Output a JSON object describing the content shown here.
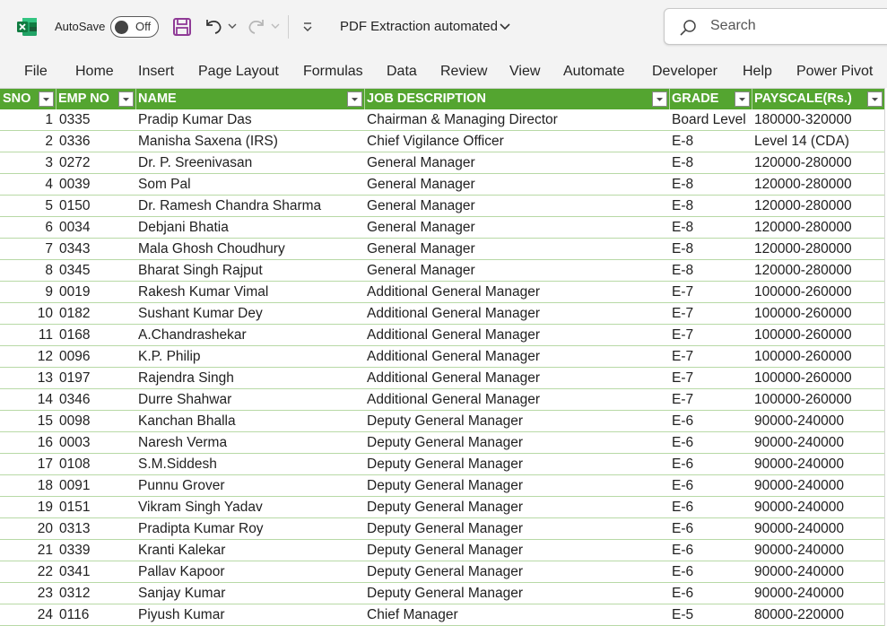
{
  "titlebar": {
    "autosave_label": "AutoSave",
    "autosave_state": "Off",
    "document_title": "PDF Extraction automated",
    "search_placeholder": "Search"
  },
  "ribbon": {
    "tabs": [
      "File",
      "Home",
      "Insert",
      "Page Layout",
      "Formulas",
      "Data",
      "Review",
      "View",
      "Automate",
      "Developer",
      "Help",
      "Power Pivot"
    ]
  },
  "colors": {
    "header_green": "#54a530",
    "row_border": "#b8d9a6",
    "excel_green": "#107c41",
    "save_purple": "#8f3a96"
  },
  "table": {
    "headers": [
      "SNO",
      "EMP NO",
      "NAME",
      "JOB DESCRIPTION",
      "GRADE",
      "PAYSCALE(Rs.)"
    ],
    "rows": [
      [
        "1",
        "0335",
        "Pradip Kumar Das",
        "Chairman & Managing Director",
        "Board Level",
        "180000-320000"
      ],
      [
        "2",
        "0336",
        "Manisha Saxena (IRS)",
        "Chief Vigilance Officer",
        "E-8",
        "Level 14 (CDA)"
      ],
      [
        "3",
        "0272",
        "Dr. P. Sreenivasan",
        "General Manager",
        "E-8",
        "120000-280000"
      ],
      [
        "4",
        "0039",
        "Som Pal",
        "General Manager",
        "E-8",
        "120000-280000"
      ],
      [
        "5",
        "0150",
        "Dr. Ramesh Chandra Sharma",
        "General Manager",
        "E-8",
        "120000-280000"
      ],
      [
        "6",
        "0034",
        "Debjani Bhatia",
        "General Manager",
        "E-8",
        "120000-280000"
      ],
      [
        "7",
        "0343",
        "Mala Ghosh Choudhury",
        "General Manager",
        "E-8",
        "120000-280000"
      ],
      [
        "8",
        "0345",
        "Bharat Singh Rajput",
        "General Manager",
        "E-8",
        "120000-280000"
      ],
      [
        "9",
        "0019",
        "Rakesh Kumar Vimal",
        "Additional General Manager",
        "E-7",
        "100000-260000"
      ],
      [
        "10",
        "0182",
        "Sushant Kumar Dey",
        "Additional General Manager",
        "E-7",
        "100000-260000"
      ],
      [
        "11",
        "0168",
        "A.Chandrashekar",
        "Additional General Manager",
        "E-7",
        "100000-260000"
      ],
      [
        "12",
        "0096",
        "K.P. Philip",
        "Additional General Manager",
        "E-7",
        "100000-260000"
      ],
      [
        "13",
        "0197",
        "Rajendra Singh",
        "Additional General Manager",
        "E-7",
        "100000-260000"
      ],
      [
        "14",
        "0346",
        "Durre Shahwar",
        "Additional General Manager",
        "E-7",
        "100000-260000"
      ],
      [
        "15",
        "0098",
        "Kanchan Bhalla",
        "Deputy General Manager",
        "E-6",
        "90000-240000"
      ],
      [
        "16",
        "0003",
        "Naresh Verma",
        "Deputy General Manager",
        "E-6",
        "90000-240000"
      ],
      [
        "17",
        "0108",
        "S.M.Siddesh",
        "Deputy General Manager",
        "E-6",
        "90000-240000"
      ],
      [
        "18",
        "0091",
        "Punnu Grover",
        "Deputy General Manager",
        "E-6",
        "90000-240000"
      ],
      [
        "19",
        "0151",
        "Vikram Singh Yadav",
        "Deputy General Manager",
        "E-6",
        "90000-240000"
      ],
      [
        "20",
        "0313",
        "Pradipta Kumar Roy",
        "Deputy General Manager",
        "E-6",
        "90000-240000"
      ],
      [
        "21",
        "0339",
        "Kranti Kalekar",
        "Deputy General Manager",
        "E-6",
        "90000-240000"
      ],
      [
        "22",
        "0341",
        "Pallav Kapoor",
        "Deputy General Manager",
        "E-6",
        "90000-240000"
      ],
      [
        "23",
        "0312",
        "Sanjay Kumar",
        "Deputy General Manager",
        "E-6",
        "90000-240000"
      ],
      [
        "24",
        "0116",
        "Piyush Kumar",
        "Chief Manager",
        "E-5",
        "80000-220000"
      ]
    ]
  }
}
